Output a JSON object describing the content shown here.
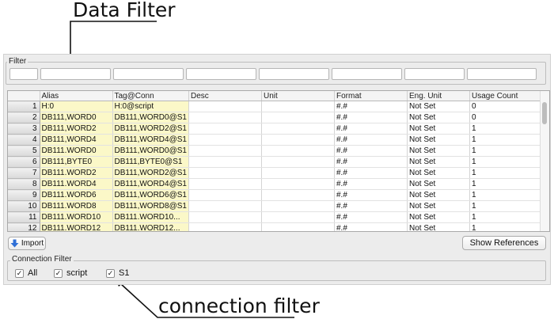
{
  "annotations": {
    "data_filter": "Data Filter",
    "connection_filter": "connection filter"
  },
  "filter": {
    "label": "Filter",
    "fields": [
      "",
      "",
      "",
      "",
      "",
      "",
      "",
      ""
    ]
  },
  "table": {
    "columns": [
      "Alias",
      "Tag@Conn",
      "Desc",
      "Unit",
      "Format",
      "Eng. Unit",
      "Usage Count"
    ],
    "rows": [
      {
        "n": "1",
        "alias": "H:0",
        "tag": "H:0@script",
        "desc": "",
        "unit": "",
        "format": "#.#",
        "eng": "Not Set",
        "usage": "0"
      },
      {
        "n": "2",
        "alias": "DB111,WORD0",
        "tag": "DB111,WORD0@S1",
        "desc": "",
        "unit": "",
        "format": "#.#",
        "eng": "Not Set",
        "usage": "0"
      },
      {
        "n": "3",
        "alias": "DB111,WORD2",
        "tag": "DB111,WORD2@S1",
        "desc": "",
        "unit": "",
        "format": "#.#",
        "eng": "Not Set",
        "usage": "1"
      },
      {
        "n": "4",
        "alias": "DB111,WORD4",
        "tag": "DB111,WORD4@S1",
        "desc": "",
        "unit": "",
        "format": "#.#",
        "eng": "Not Set",
        "usage": "1"
      },
      {
        "n": "5",
        "alias": "DB111.WORD0",
        "tag": "DB111,WORD0@S1",
        "desc": "",
        "unit": "",
        "format": "#.#",
        "eng": "Not Set",
        "usage": "1"
      },
      {
        "n": "6",
        "alias": "DB111,BYTE0",
        "tag": "DB111,BYTE0@S1",
        "desc": "",
        "unit": "",
        "format": "#.#",
        "eng": "Not Set",
        "usage": "1"
      },
      {
        "n": "7",
        "alias": "DB111.WORD2",
        "tag": "DB111,WORD2@S1",
        "desc": "",
        "unit": "",
        "format": "#.#",
        "eng": "Not Set",
        "usage": "1"
      },
      {
        "n": "8",
        "alias": "DB111.WORD4",
        "tag": "DB111,WORD4@S1",
        "desc": "",
        "unit": "",
        "format": "#.#",
        "eng": "Not Set",
        "usage": "1"
      },
      {
        "n": "9",
        "alias": "DB111.WORD6",
        "tag": "DB111,WORD6@S1",
        "desc": "",
        "unit": "",
        "format": "#.#",
        "eng": "Not Set",
        "usage": "1"
      },
      {
        "n": "10",
        "alias": "DB111.WORD8",
        "tag": "DB111,WORD8@S1",
        "desc": "",
        "unit": "",
        "format": "#.#",
        "eng": "Not Set",
        "usage": "1"
      },
      {
        "n": "11",
        "alias": "DB111.WORD10",
        "tag": "DB111.WORD10...",
        "desc": "",
        "unit": "",
        "format": "#.#",
        "eng": "Not Set",
        "usage": "1"
      },
      {
        "n": "12",
        "alias": "DB111.WORD12",
        "tag": "DB111.WORD12...",
        "desc": "",
        "unit": "",
        "format": "#.#",
        "eng": "Not Set",
        "usage": "1"
      }
    ]
  },
  "toolbar": {
    "import_label": "Import",
    "show_references_label": "Show References"
  },
  "connection_filter": {
    "label": "Connection Filter",
    "items": [
      {
        "label": "All",
        "checked": true
      },
      {
        "label": "script",
        "checked": true
      },
      {
        "label": "S1",
        "checked": true
      }
    ]
  },
  "colors": {
    "alias_bg": "#fbf8c8",
    "import_icon": "#2f6fd6",
    "panel_bg": "#ececec"
  },
  "icons": [
    "import-arrow-icon",
    "check-icon"
  ]
}
